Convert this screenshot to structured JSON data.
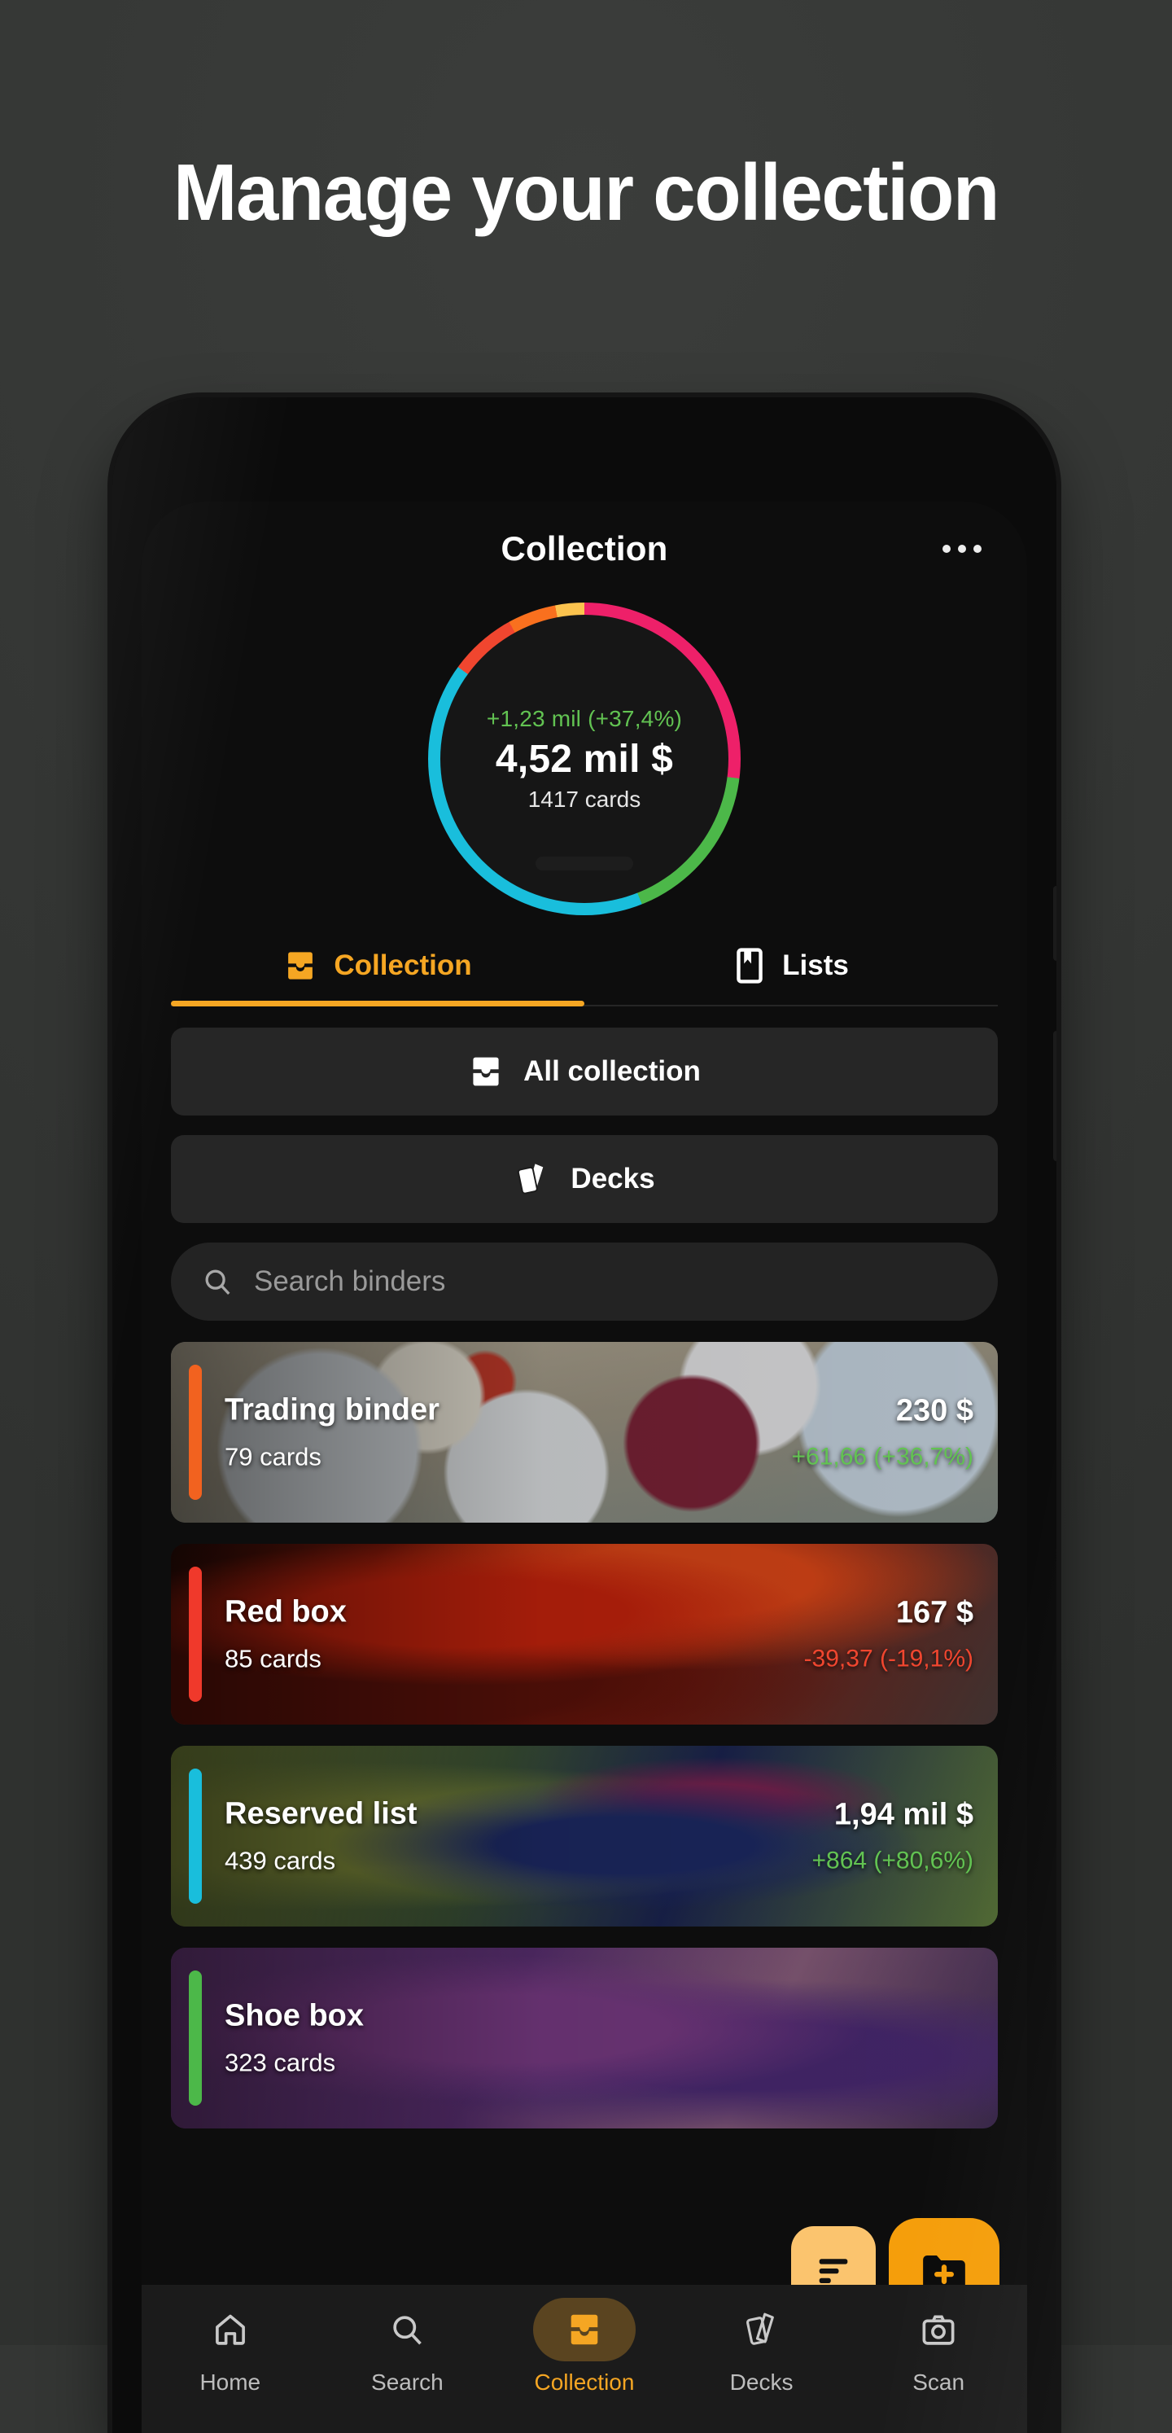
{
  "headline": "Manage your collection",
  "app": {
    "header": {
      "title": "Collection",
      "menu_icon": "kebab-menu-icon"
    },
    "summary": {
      "delta": "+1,23 mil (+37,4%)",
      "total": "4,52 mil $",
      "cards": "1417 cards",
      "delta_color": "#62c352"
    },
    "tabs": [
      {
        "label": "Collection",
        "icon": "collection-tray-icon",
        "active": true
      },
      {
        "label": "Lists",
        "icon": "bookmark-icon",
        "active": false
      }
    ],
    "buttons": [
      {
        "label": "All collection",
        "icon": "collection-tray-icon"
      },
      {
        "label": "Decks",
        "icon": "decks-cards-icon"
      }
    ],
    "search": {
      "placeholder": "Search binders",
      "icon": "search-icon"
    },
    "binders": [
      {
        "name": "Trading binder",
        "count": "79 cards",
        "price": "230 $",
        "change": "+61,66 (+36,7%)",
        "change_color": "#62c352",
        "accent": "#F2621F"
      },
      {
        "name": "Red box",
        "count": "85 cards",
        "price": "167 $",
        "change": "-39,37 (-19,1%)",
        "change_color": "#F0462F",
        "accent": "#F0392B"
      },
      {
        "name": "Reserved list",
        "count": "439 cards",
        "price": "1,94 mil $",
        "change": "+864 (+80,6%)",
        "change_color": "#62c352",
        "accent": "#19BEDC"
      },
      {
        "name": "Shoe box",
        "count": "323 cards",
        "price": "",
        "change": "",
        "change_color": "#62c352",
        "accent": "#4CB849"
      }
    ],
    "fabs": [
      {
        "name": "sort-fab",
        "icon": "sort-lines-icon",
        "color": "#FBC46E"
      },
      {
        "name": "add-folder-fab",
        "icon": "folder-plus-icon",
        "color": "#F59E0B"
      }
    ],
    "nav": [
      {
        "label": "Home",
        "icon": "home-icon",
        "active": false
      },
      {
        "label": "Search",
        "icon": "search-icon",
        "active": false
      },
      {
        "label": "Collection",
        "icon": "collection-tray-icon",
        "active": true
      },
      {
        "label": "Decks",
        "icon": "decks-cards-icon",
        "active": false
      },
      {
        "label": "Scan",
        "icon": "camera-icon",
        "active": false
      }
    ]
  },
  "chart_data": {
    "type": "pie",
    "title": "Collection value breakdown",
    "labels": [
      "Magenta segment",
      "Green segment",
      "Cyan segment",
      "Red-orange segment",
      "Orange segment",
      "Yellow segment"
    ],
    "values": [
      27,
      17,
      41,
      7,
      5,
      3
    ],
    "colors": [
      "#EE2069",
      "#4CB849",
      "#19BEDC",
      "#F0462F",
      "#F9701E",
      "#FBC34E"
    ],
    "center_label": "4,52 mil $",
    "center_sub": "1417 cards",
    "center_delta": "+1,23 mil (+37,4%)",
    "legend": "none"
  }
}
